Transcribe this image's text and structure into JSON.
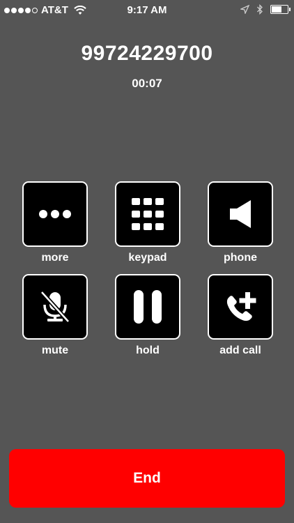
{
  "status_bar": {
    "carrier": "AT&T",
    "time": "9:17 AM",
    "signal_bars_filled": 4,
    "signal_bars_total": 5,
    "battery_level": 0.6
  },
  "call": {
    "number": "99724229700",
    "duration": "00:07"
  },
  "controls": [
    {
      "label": "more",
      "icon": "more-dots-icon"
    },
    {
      "label": "keypad",
      "icon": "keypad-grid-icon"
    },
    {
      "label": "phone",
      "icon": "speaker-icon"
    },
    {
      "label": "mute",
      "icon": "microphone-muted-icon"
    },
    {
      "label": "hold",
      "icon": "pause-icon"
    },
    {
      "label": "add call",
      "icon": "add-call-icon"
    }
  ],
  "end_button": {
    "label": "End"
  },
  "colors": {
    "background": "#555555",
    "control_bg": "#000000",
    "end": "#ff0000"
  }
}
